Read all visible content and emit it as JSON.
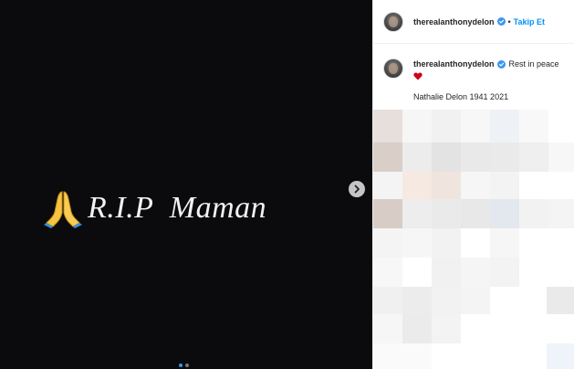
{
  "post": {
    "image_text": "R.I.P  Maman",
    "carousel_dots": 2,
    "active_dot": 0
  },
  "header": {
    "username": "therealanthonydelon",
    "separator": "•",
    "follow_label": "Takip Et"
  },
  "caption": {
    "username": "therealanthonydelon",
    "text": "Rest in peace",
    "second_line": "Nathalie Delon 1941 2021"
  },
  "colors": {
    "accent": "#0095f6",
    "verified": "#3897f0",
    "heart": "#d0021b",
    "media_bg": "#0b0b0d"
  },
  "icons": [
    "praying-hands-icon",
    "chevron-right-icon",
    "verified-badge-icon",
    "red-heart-icon"
  ]
}
